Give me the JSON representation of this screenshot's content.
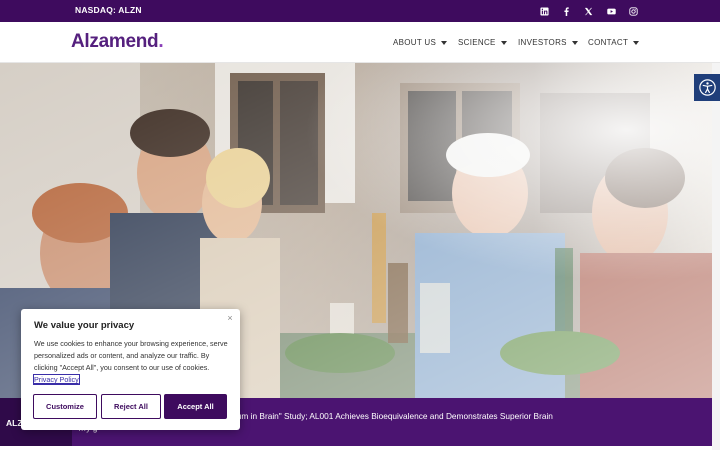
{
  "topbar": {
    "ticker": "NASDAQ: ALZN",
    "social": [
      {
        "icon": "linkedin-icon"
      },
      {
        "icon": "facebook-icon"
      },
      {
        "icon": "x-icon"
      },
      {
        "icon": "youtube-icon"
      },
      {
        "icon": "instagram-icon"
      }
    ]
  },
  "header": {
    "logo_text": "Alzamend",
    "logo_dot": ".",
    "nav": [
      {
        "label": "ABOUT US"
      },
      {
        "label": "SCIENCE"
      },
      {
        "label": "INVESTORS"
      },
      {
        "label": "CONTACT"
      }
    ]
  },
  "newsbar": {
    "label": "ALZN",
    "headline": "a from Phase II Clinical Trial of AL001 \"Lithium in Brain\" Study; AL001 Achieves Bioequivalence and Demonstrates Superior Brain",
    "headline_cont": "…y                                g"
  },
  "cookie": {
    "title": "We value your privacy",
    "close": "×",
    "body": "We use cookies to enhance your browsing experience, serve personalized ads or content, and analyze our traffic. By clicking \"Accept All\", you consent to our use of cookies.",
    "policy_link": "Privacy Policy",
    "buttons": {
      "customize": "Customize",
      "reject": "Reject All",
      "accept": "Accept All"
    }
  },
  "colors": {
    "brand_purple": "#3e0b5e",
    "logo_purple": "#55207e",
    "accessibility_blue": "#1f3e7a"
  }
}
